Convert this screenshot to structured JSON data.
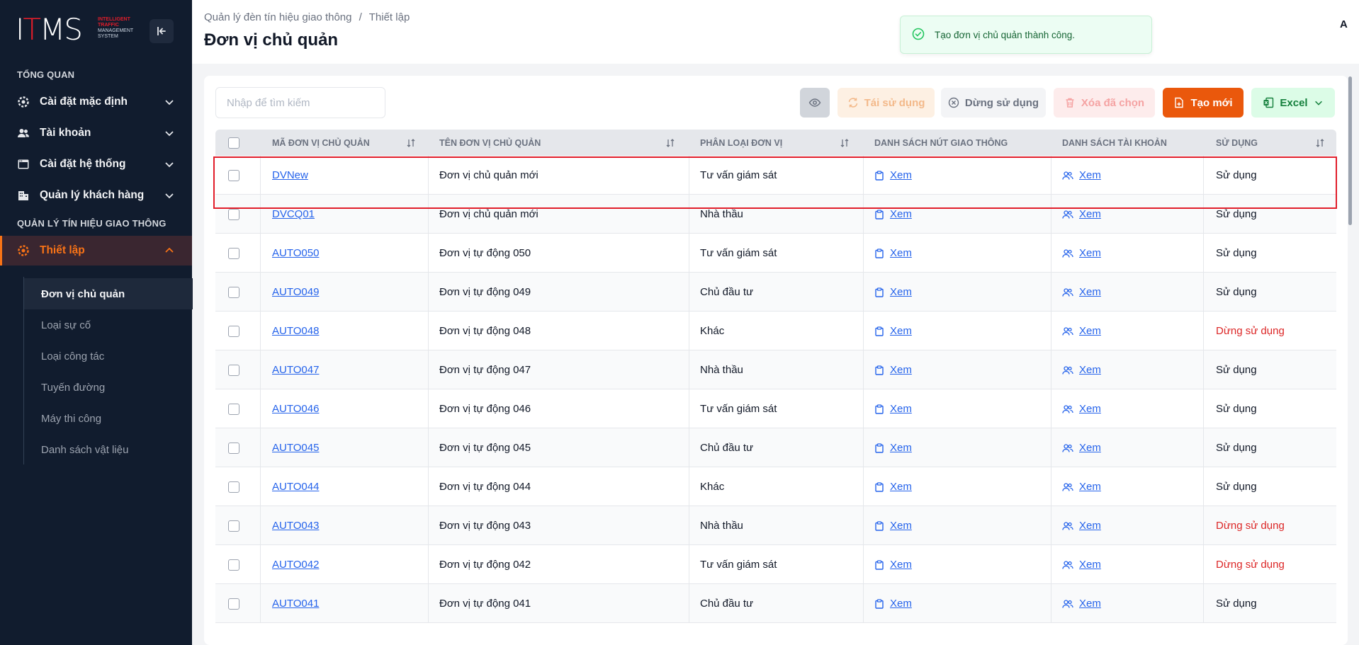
{
  "logo": {
    "main": "ITMS",
    "sub_lines": [
      "INTELLIGENT",
      "TRAFFIC",
      "MANAGEMENT",
      "SYSTEM"
    ]
  },
  "sidebar": {
    "section_overview": "TỔNG QUAN",
    "menu": [
      {
        "label": "Cài đặt mặc định",
        "icon": "gear-icon"
      },
      {
        "label": "Tài khoản",
        "icon": "users-icon"
      },
      {
        "label": "Cài đặt hệ thống",
        "icon": "window-icon"
      },
      {
        "label": "Quản lý khách hàng",
        "icon": "building-icon"
      }
    ],
    "section_signal": "QUẢN LÝ TÍN HIỆU GIAO THÔNG",
    "active_menu": {
      "label": "Thiết lập",
      "icon": "gear-icon"
    },
    "submenu": [
      {
        "label": "Đơn vị chủ quản",
        "active": true
      },
      {
        "label": "Loại sự cố",
        "active": false
      },
      {
        "label": "Loại công tác",
        "active": false
      },
      {
        "label": "Tuyến đường",
        "active": false
      },
      {
        "label": "Máy thi công",
        "active": false
      },
      {
        "label": "Danh sách vật liệu",
        "active": false
      }
    ]
  },
  "header": {
    "breadcrumb_parent": "Quản lý đèn tín hiệu giao thông",
    "breadcrumb_sep": "/",
    "breadcrumb_current": "Thiết lập",
    "title": "Đơn vị chủ quản",
    "initial": "A"
  },
  "toast": {
    "message": "Tạo đơn vị chủ quản thành công.",
    "color": "#166534"
  },
  "toolbar": {
    "search_placeholder": "Nhập để tìm kiếm",
    "reuse_label": "Tái sử dụng",
    "stop_label": "Dừng sử dụng",
    "delete_label": "Xóa đã chọn",
    "new_label": "Tạo mới",
    "excel_label": "Excel"
  },
  "table": {
    "headers": {
      "code": "MÃ ĐƠN VỊ CHỦ QUẢN",
      "name": "TÊN ĐƠN VỊ CHỦ QUẢN",
      "type": "PHÂN LOẠI ĐƠN VỊ",
      "nodes": "DANH SÁCH NÚT GIAO THÔNG",
      "accounts": "DANH SÁCH TÀI KHOẢN",
      "usage": "SỬ DỤNG"
    },
    "rows": [
      {
        "code": "DVNew",
        "name": "Đơn vị chủ quản mới",
        "type": "Tư vấn giám sát",
        "nodes": "Xem",
        "accounts": "Xem",
        "usage": "Sử dụng",
        "active": true
      },
      {
        "code": "DVCQ01",
        "name": "Đơn vị chủ quản mới",
        "type": "Nhà thầu",
        "nodes": "Xem",
        "accounts": "Xem",
        "usage": "Sử dụng",
        "active": true
      },
      {
        "code": "AUTO050",
        "name": "Đơn vị tự động 050",
        "type": "Tư vấn giám sát",
        "nodes": "Xem",
        "accounts": "Xem",
        "usage": "Sử dụng",
        "active": true
      },
      {
        "code": "AUTO049",
        "name": "Đơn vị tự động 049",
        "type": "Chủ đầu tư",
        "nodes": "Xem",
        "accounts": "Xem",
        "usage": "Sử dụng",
        "active": true
      },
      {
        "code": "AUTO048",
        "name": "Đơn vị tự động 048",
        "type": "Khác",
        "nodes": "Xem",
        "accounts": "Xem",
        "usage": "Dừng sử dụng",
        "active": false
      },
      {
        "code": "AUTO047",
        "name": "Đơn vị tự động 047",
        "type": "Nhà thầu",
        "nodes": "Xem",
        "accounts": "Xem",
        "usage": "Sử dụng",
        "active": true
      },
      {
        "code": "AUTO046",
        "name": "Đơn vị tự động 046",
        "type": "Tư vấn giám sát",
        "nodes": "Xem",
        "accounts": "Xem",
        "usage": "Sử dụng",
        "active": true
      },
      {
        "code": "AUTO045",
        "name": "Đơn vị tự động 045",
        "type": "Chủ đầu tư",
        "nodes": "Xem",
        "accounts": "Xem",
        "usage": "Sử dụng",
        "active": true
      },
      {
        "code": "AUTO044",
        "name": "Đơn vị tự động 044",
        "type": "Khác",
        "nodes": "Xem",
        "accounts": "Xem",
        "usage": "Sử dụng",
        "active": true
      },
      {
        "code": "AUTO043",
        "name": "Đơn vị tự động 043",
        "type": "Nhà thầu",
        "nodes": "Xem",
        "accounts": "Xem",
        "usage": "Dừng sử dụng",
        "active": false
      },
      {
        "code": "AUTO042",
        "name": "Đơn vị tự động 042",
        "type": "Tư vấn giám sát",
        "nodes": "Xem",
        "accounts": "Xem",
        "usage": "Dừng sử dụng",
        "active": false
      },
      {
        "code": "AUTO041",
        "name": "Đơn vị tự động 041",
        "type": "Chủ đầu tư",
        "nodes": "Xem",
        "accounts": "Xem",
        "usage": "Sử dụng",
        "active": true
      }
    ]
  },
  "colors": {
    "accent": "#ea580c",
    "sidebar_bg": "#111c2e",
    "link": "#2563eb",
    "status_off": "#dc2626",
    "highlight": "#e11d2a"
  }
}
